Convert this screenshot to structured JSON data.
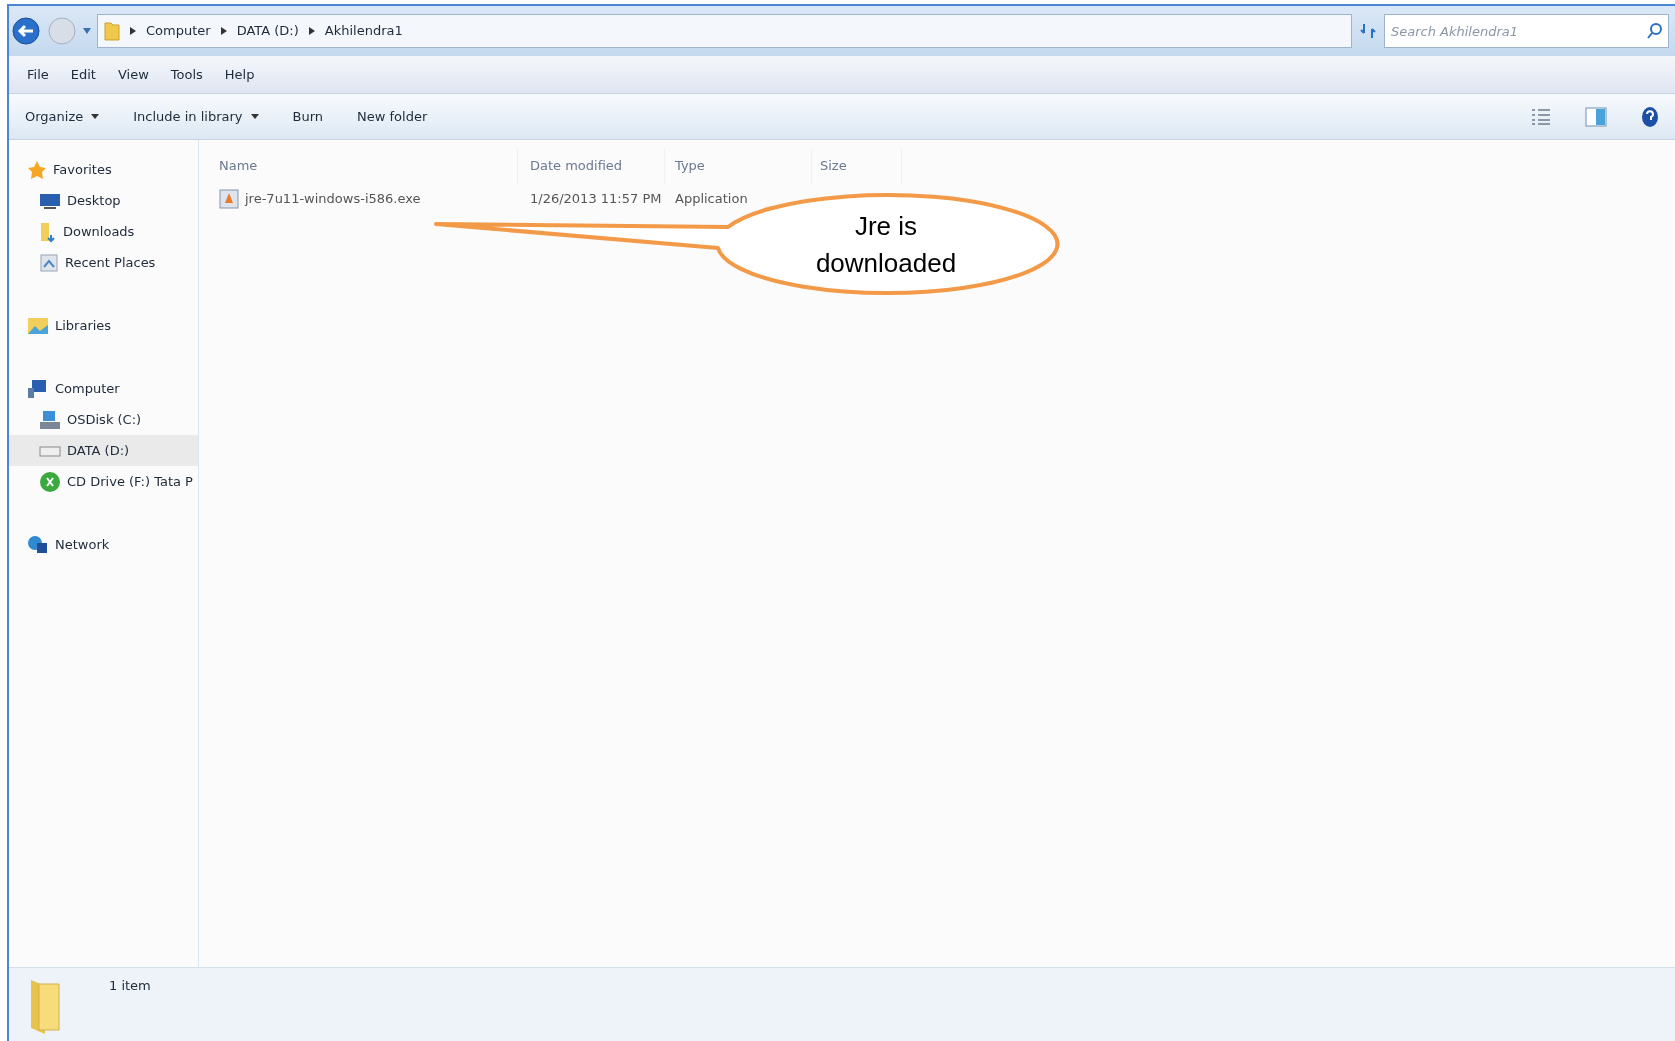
{
  "address_bar": {
    "breadcrumbs": [
      "Computer",
      "DATA (D:)",
      "Akhilendra1"
    ]
  },
  "search": {
    "placeholder": "Search Akhilendra1"
  },
  "menu_bar": [
    "File",
    "Edit",
    "View",
    "Tools",
    "Help"
  ],
  "toolbar": [
    {
      "label": "Organize",
      "dropdown": true
    },
    {
      "label": "Include in library",
      "dropdown": true
    },
    {
      "label": "Burn",
      "dropdown": false
    },
    {
      "label": "New folder",
      "dropdown": false
    }
  ],
  "sidebar": {
    "items": [
      {
        "label": "Favorites",
        "selected": false,
        "children": [
          {
            "label": "Desktop",
            "selected": false
          },
          {
            "label": "Downloads",
            "selected": false
          },
          {
            "label": "Recent Places",
            "selected": false
          }
        ]
      },
      {
        "label": "Libraries",
        "selected": false
      },
      {
        "label": "Computer",
        "selected": false,
        "children": [
          {
            "label": "OSDisk (C:)",
            "selected": false
          },
          {
            "label": "DATA (D:)",
            "selected": true
          },
          {
            "label": "CD Drive (F:) Tata P",
            "selected": false
          }
        ]
      },
      {
        "label": "Network",
        "selected": false
      }
    ]
  },
  "file_list": {
    "columns": [
      "Name",
      "Date modified",
      "Type",
      "Size"
    ],
    "rows": [
      {
        "name": "jre-7u11-windows-i586.exe",
        "date_modified": "1/26/2013 11:57 PM",
        "type": "Application"
      }
    ]
  },
  "callout": {
    "text": "Jre is downloaded"
  },
  "status_bar": {
    "text": "1 item"
  }
}
